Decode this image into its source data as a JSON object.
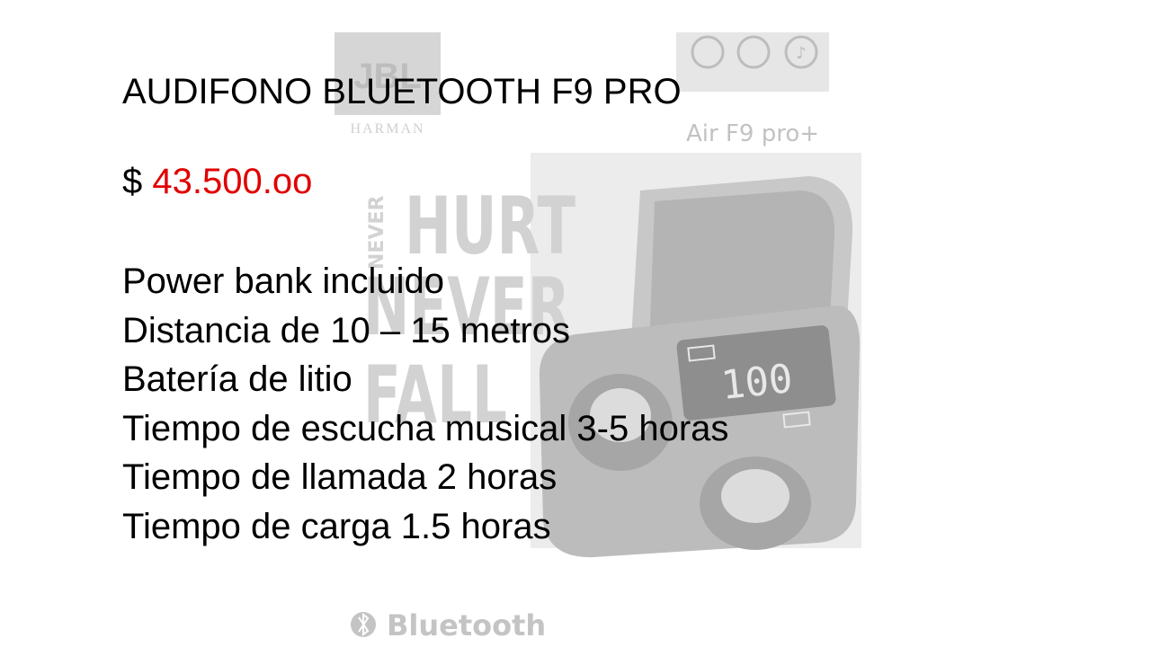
{
  "product": {
    "title": "AUDIFONO BLUETOOTH F9 PRO",
    "currency": "$",
    "price": "43.500.oo",
    "price_color": "#e00000",
    "features": [
      "Power bank incluido",
      "Distancia de 10 – 15 metros",
      "Batería de litio",
      "Tiempo de escucha musical 3-5 horas",
      "Tiempo de llamada 2 horas",
      "Tiempo de carga 1.5 horas"
    ]
  },
  "background_art": {
    "brand_logo": "JBL",
    "brand_sub": "HARMAN",
    "model_label": "Air F9 pro+",
    "slogan_words": [
      "NEVER",
      "HURT",
      "NEVER",
      "FALL"
    ],
    "bluetooth_label": "Bluetooth",
    "feature_icons": [
      "leaf-icon",
      "hifi-icon",
      "music-note-icon"
    ],
    "display_readout": "100"
  }
}
